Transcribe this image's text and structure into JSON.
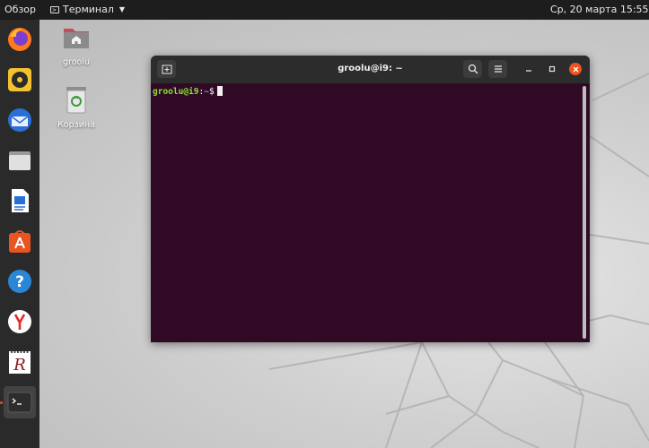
{
  "topbar": {
    "activities": "Обзор",
    "app_name": "Терминал",
    "clock": "Ср, 20 марта  15:55"
  },
  "dock": {
    "items": [
      {
        "name": "firefox-icon"
      },
      {
        "name": "rhythmbox-icon"
      },
      {
        "name": "thunderbird-icon"
      },
      {
        "name": "files-icon"
      },
      {
        "name": "libreoffice-writer-icon"
      },
      {
        "name": "software-center-icon"
      },
      {
        "name": "help-icon"
      },
      {
        "name": "yandex-browser-icon"
      },
      {
        "name": "r-icon"
      },
      {
        "name": "terminal-icon"
      }
    ]
  },
  "desktop_icons": [
    {
      "label": "groolu",
      "icon": "home-folder-icon"
    },
    {
      "label": "Корзина",
      "icon": "trash-icon"
    }
  ],
  "terminal": {
    "title": "groolu@i9: ~",
    "prompt_user": "groolu@i9",
    "prompt_sep": ":",
    "prompt_path": "~",
    "prompt_dollar": "$",
    "theme": {
      "background": "#300a24",
      "user_color": "#8ae234",
      "path_color": "#729fcf"
    }
  },
  "colors": {
    "accent": "#e95420",
    "topbar": "#1d1d1d",
    "dock": "#2a2a2a"
  }
}
